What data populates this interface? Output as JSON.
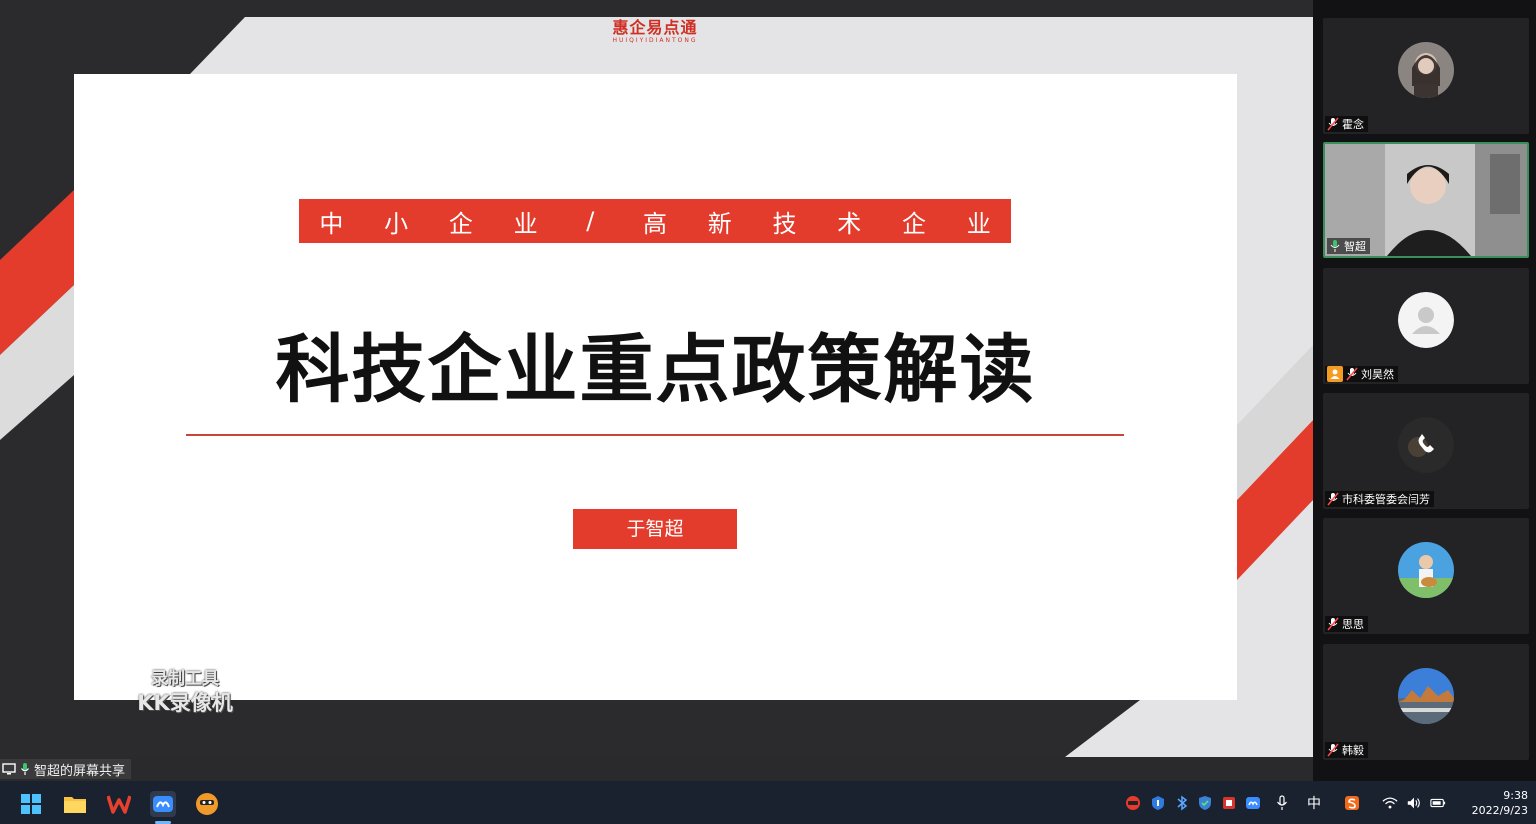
{
  "slide": {
    "brand_cn": "惠企易点通",
    "brand_en": "HUIQIYIDIANTONG",
    "subtitle_chars": [
      "中",
      "小",
      "企",
      "业",
      "/",
      "高",
      "新",
      "技",
      "术",
      "企",
      "业"
    ],
    "title": "科技企业重点政策解读",
    "presenter": "于智超",
    "colors": {
      "accent_red": "#e33b2c",
      "dark_gray": "#2b2b2d",
      "light_gray": "#e4e4e6"
    }
  },
  "watermark": {
    "line1": "录制工具",
    "line2": "KK录像机"
  },
  "share_status": {
    "label": "智超的屏幕共享",
    "icon": "mic-active-icon"
  },
  "participants": [
    {
      "name": "霍念",
      "mic": "muted",
      "video": "avatar-photo"
    },
    {
      "name": "智超",
      "mic": "active",
      "video": "camera-on",
      "speaking": true
    },
    {
      "name": "刘昊然",
      "mic": "muted",
      "video": "default-avatar",
      "host": true
    },
    {
      "name": "市科委管委会闫芳",
      "mic": "muted",
      "video": "phone-avatar"
    },
    {
      "name": "思思",
      "mic": "muted",
      "video": "avatar-photo"
    },
    {
      "name": "韩毅",
      "mic": "muted",
      "video": "avatar-photo"
    }
  ],
  "taskbar": {
    "apps": [
      "start-icon",
      "file-explorer-icon",
      "wps-icon",
      "tencent-meeting-icon",
      "kk-recorder-icon"
    ],
    "tray": [
      "kk-tray-icon",
      "tray-app-icon",
      "bluetooth-icon",
      "security-icon",
      "red-app-icon",
      "meeting-tray-icon",
      "microphone-icon",
      "ime-icon",
      "sogou-icon",
      "wifi-icon",
      "volume-icon",
      "battery-icon"
    ],
    "ime": "中",
    "time": "9:38",
    "date": "2022/9/23"
  }
}
